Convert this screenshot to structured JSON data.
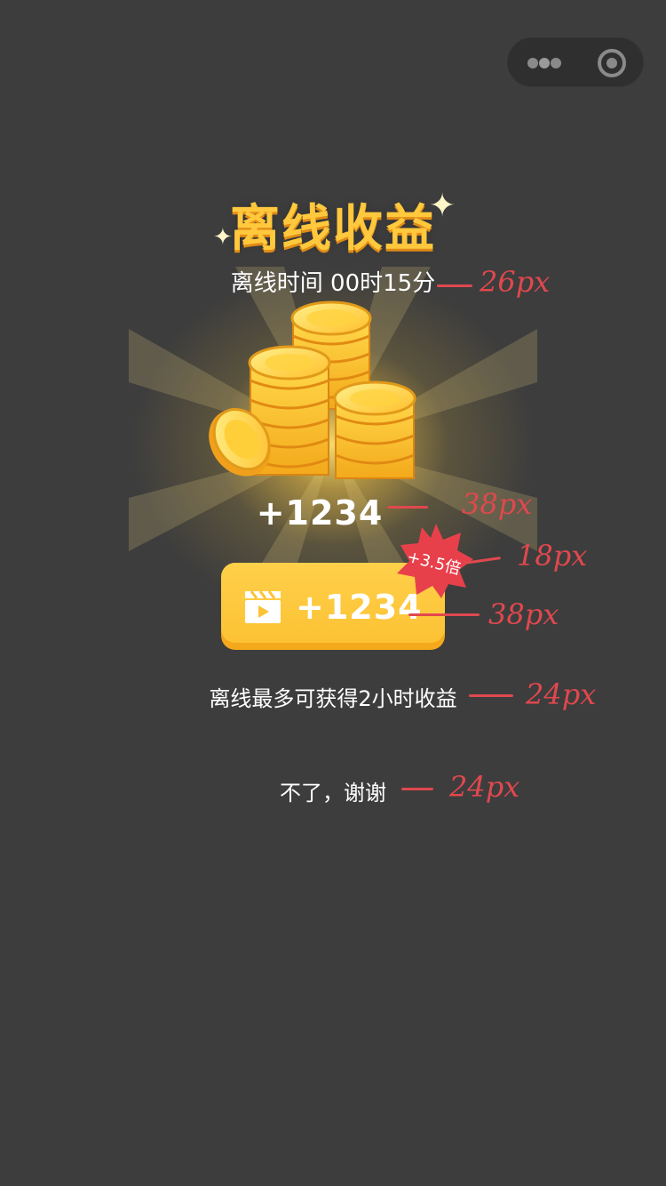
{
  "capsule": {
    "more_icon": "more-dots-icon",
    "close_icon": "close-circle-icon"
  },
  "dialog": {
    "title": "离线收益",
    "offline_time": "离线时间 00时15分",
    "reward_amount": "+1234",
    "video_button": {
      "icon": "video-clapper-icon",
      "label": "+1234"
    },
    "bonus_badge": "+3.5倍",
    "max_hint": "离线最多可获得2小时收益",
    "decline_link": "不了，谢谢"
  },
  "annotations": {
    "offline_time_size": "26px",
    "reward_amount_size": "38px",
    "bonus_badge_size": "18px",
    "video_label_size": "38px",
    "max_hint_size": "24px",
    "decline_size": "24px"
  },
  "colors": {
    "background": "#3d3d3d",
    "title": "#ffc83d",
    "button": "#fcc234",
    "badge": "#e8404b",
    "annotation": "#e0484e"
  }
}
